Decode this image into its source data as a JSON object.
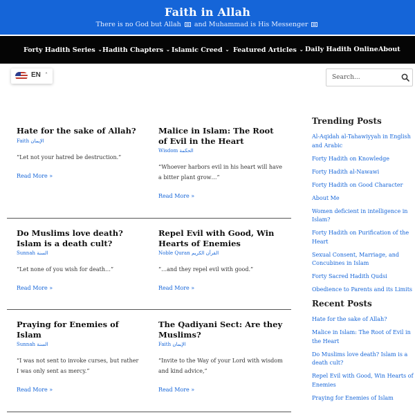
{
  "header": {
    "title": "Faith in Allah",
    "tagline_pre": "There is no God but Allah",
    "tagline_mid": "and Muhammad is His Messenger"
  },
  "nav": {
    "items": [
      {
        "label": "Forty Hadith Series",
        "has_dropdown": true
      },
      {
        "label": "Hadith Chapters",
        "has_dropdown": true
      },
      {
        "label": "Islamic Creed",
        "has_dropdown": true
      },
      {
        "label": "Featured Articles",
        "has_dropdown": true
      },
      {
        "label": "Daily Hadith Online",
        "has_dropdown": false
      },
      {
        "label": "About",
        "has_dropdown": false
      }
    ],
    "caret": "⌄"
  },
  "language": {
    "code": "EN",
    "caret": "˄"
  },
  "search": {
    "placeholder": "Search..."
  },
  "posts": [
    {
      "title": "Hate for the sake of Allah?",
      "category": "Faith الإيمان",
      "excerpt": "“Let not your hatred be destruction.”",
      "more": "Read More »"
    },
    {
      "title": "Malice in Islam: The Root of Evil in the Heart",
      "category": "Wisdom الحكمة",
      "excerpt": "“Whoever harbors evil in his heart will have a bitter plant grow…”",
      "more": "Read More »"
    },
    {
      "title": "Do Muslims love death? Islam is a death cult?",
      "category": "Sunnah السنة",
      "excerpt": "“Let none of you wish for death…”",
      "more": "Read More »"
    },
    {
      "title": "Repel Evil with Good, Win Hearts of Enemies",
      "category": "Noble Quran القرآن الكريم",
      "excerpt": "“…and they repel evil with good.”",
      "more": "Read More »"
    },
    {
      "title": "Praying for Enemies of Islam",
      "category": "Sunnah السنة",
      "excerpt": "“I was not sent to invoke curses, but rather I was only sent as mercy.”",
      "more": "Read More »"
    },
    {
      "title": "The Qadiyani Sect: Are they Muslims?",
      "category": "Faith الإيمان",
      "excerpt": "“Invite to the Way of your Lord with wisdom and kind advice,”",
      "more": "Read More »"
    }
  ],
  "sidebar": {
    "trending_title": "Trending Posts",
    "trending": [
      "Al-Aqidah al-Tahawiyyah in English and Arabic",
      "Forty Hadith on Knowledge",
      "Forty Hadith al-Nawawi",
      "Forty Hadith on Good Character",
      "About Me",
      "Women deficient in intelligence in Islam?",
      "Forty Hadith on Purification of the Heart",
      "Sexual Consent, Marriage, and Concubines in Islam",
      "Forty Sacred Hadith Qudsi",
      "Obedience to Parents and its Limits"
    ],
    "recent_title": "Recent Posts",
    "recent": [
      "Hate for the sake of Allah?",
      "Malice in Islam: The Root of Evil in the Heart",
      "Do Muslims love death? Islam is a death cult?",
      "Repel Evil with Good, Win Hearts of Enemies",
      "Praying for Enemies of Islam"
    ]
  },
  "colors": {
    "header_bg": "#1565d8",
    "nav_bg": "#050505",
    "link": "#1565d8"
  }
}
